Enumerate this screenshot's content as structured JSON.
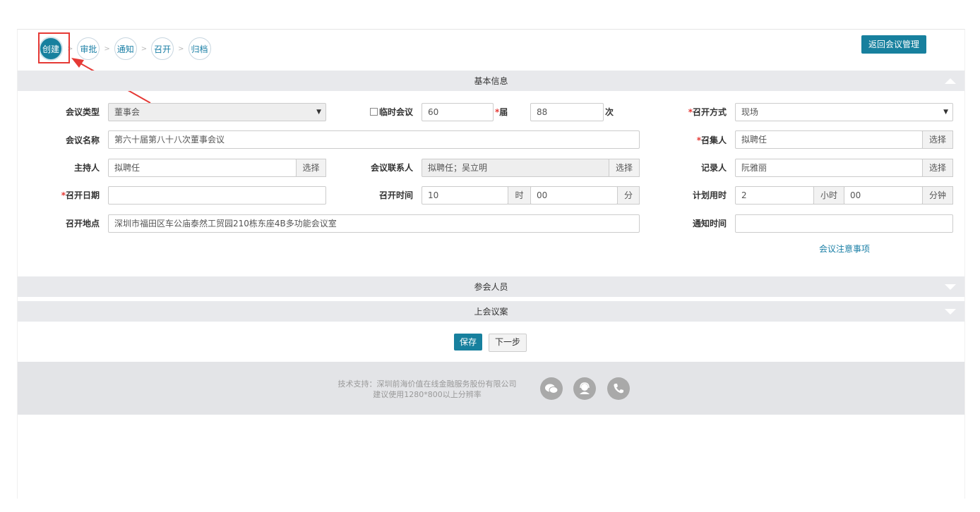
{
  "steps": [
    {
      "label": "创建",
      "active": true
    },
    {
      "label": "审批",
      "active": false
    },
    {
      "label": "通知",
      "active": false
    },
    {
      "label": "召开",
      "active": false
    },
    {
      "label": "归档",
      "active": false
    }
  ],
  "step_separator": ">",
  "back_button": "返回会议管理",
  "sections": {
    "basic": "基本信息",
    "attendees": "参会人员",
    "agenda": "上会议案"
  },
  "form": {
    "meeting_type": {
      "label": "会议类型",
      "value": "董事会"
    },
    "temporary": {
      "label": "临时会议",
      "value": "60"
    },
    "session": {
      "label": "届",
      "value": "88"
    },
    "times_unit": "次",
    "method": {
      "label": "召开方式",
      "value": "现场"
    },
    "meeting_name": {
      "label": "会议名称",
      "value": "第六十届第八十八次董事会议"
    },
    "convener": {
      "label": "召集人",
      "value": "拟聘任",
      "button": "选择"
    },
    "host": {
      "label": "主持人",
      "value": "拟聘任",
      "button": "选择"
    },
    "contact": {
      "label": "会议联系人",
      "value": "拟聘任；吴立明",
      "button": "选择"
    },
    "recorder": {
      "label": "记录人",
      "value": "阮雅丽",
      "button": "选择"
    },
    "date": {
      "label": "召开日期",
      "value": ""
    },
    "time": {
      "label": "召开时间",
      "hour": "10",
      "hour_unit": "时",
      "minute": "00",
      "minute_unit": "分"
    },
    "planned": {
      "label": "计划用时",
      "hours": "2",
      "hours_unit": "小时",
      "minutes": "00",
      "minutes_unit": "分钟"
    },
    "location": {
      "label": "召开地点",
      "value": "深圳市福田区车公庙泰然工贸园210栋东座4B多功能会议室"
    },
    "notify_time": {
      "label": "通知时间",
      "value": ""
    },
    "notes_link": "会议注意事项"
  },
  "actions": {
    "save": "保存",
    "next": "下一步"
  },
  "footer": {
    "line1": "技术支持：深圳前海价值在线金融服务股份有限公司",
    "line2": "建议使用1280*800以上分辨率"
  },
  "colors": {
    "accent": "#17809e",
    "required": "#e53935",
    "highlight": "#e53935"
  }
}
